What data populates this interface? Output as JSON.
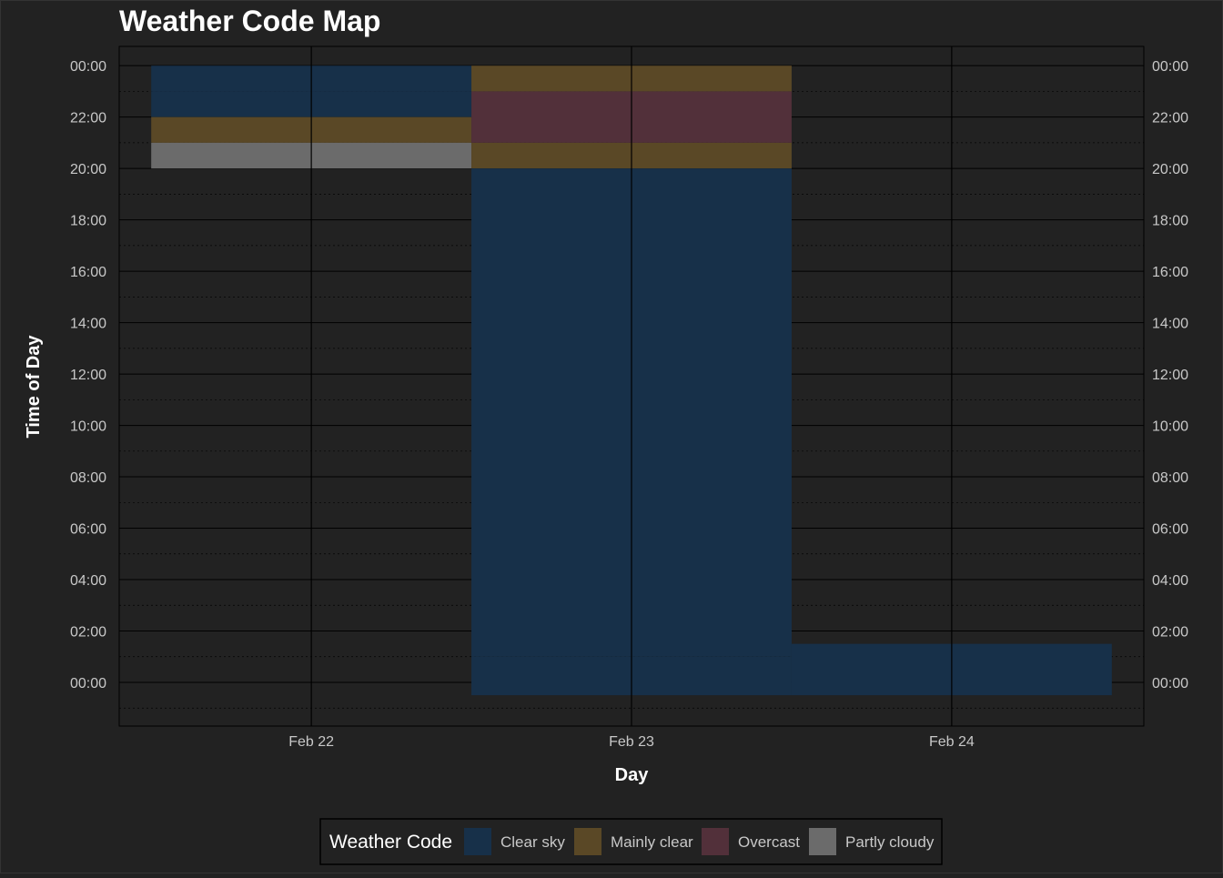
{
  "chart_data": {
    "type": "heatmap",
    "title": "Weather Code Map",
    "xlabel": "Day",
    "ylabel": "Time of Day",
    "x_ticks": [
      "Feb 22",
      "Feb 23",
      "Feb 24"
    ],
    "y_ticks": [
      "00:00",
      "02:00",
      "04:00",
      "06:00",
      "08:00",
      "10:00",
      "12:00",
      "14:00",
      "16:00",
      "18:00",
      "20:00",
      "22:00",
      "00:00"
    ],
    "y_tick_hours": [
      0,
      2,
      4,
      6,
      8,
      10,
      12,
      14,
      16,
      18,
      20,
      22,
      24
    ],
    "ylim_hours": [
      -1.7,
      24.75
    ],
    "xlim_days": [
      -0.6,
      2.6
    ],
    "grid": true,
    "secondary_y_axis": true,
    "legend_position": "bottom",
    "legend_title": "Weather Code",
    "categories": [
      {
        "name": "Clear sky",
        "color": "#173049"
      },
      {
        "name": "Mainly clear",
        "color": "#5a4826"
      },
      {
        "name": "Overcast",
        "color": "#52303a"
      },
      {
        "name": "Partly cloudy",
        "color": "#6b6b6b"
      }
    ],
    "cells": [
      {
        "day": "Feb 22",
        "day_index": 0,
        "hour_start": 23,
        "hour_end": 24,
        "code": "Clear sky"
      },
      {
        "day": "Feb 22",
        "day_index": 0,
        "hour_start": 22,
        "hour_end": 23,
        "code": "Clear sky"
      },
      {
        "day": "Feb 22",
        "day_index": 0,
        "hour_start": 21,
        "hour_end": 22,
        "code": "Mainly clear"
      },
      {
        "day": "Feb 22",
        "day_index": 0,
        "hour_start": 20,
        "hour_end": 21,
        "code": "Partly cloudy"
      },
      {
        "day": "Feb 23",
        "day_index": 1,
        "hour_start": 23,
        "hour_end": 24,
        "code": "Mainly clear"
      },
      {
        "day": "Feb 23",
        "day_index": 1,
        "hour_start": 21,
        "hour_end": 23,
        "code": "Overcast"
      },
      {
        "day": "Feb 23",
        "day_index": 1,
        "hour_start": 20,
        "hour_end": 21,
        "code": "Mainly clear"
      },
      {
        "day": "Feb 23",
        "day_index": 1,
        "hour_start": 1,
        "hour_end": 20,
        "code": "Clear sky"
      },
      {
        "day": "Feb 23",
        "day_index": 1,
        "hour_start": -0.5,
        "hour_end": 1,
        "code": "Clear sky"
      },
      {
        "day": "Feb 24",
        "day_index": 2,
        "hour_start": -0.5,
        "hour_end": 1.5,
        "code": "Clear sky"
      }
    ]
  }
}
